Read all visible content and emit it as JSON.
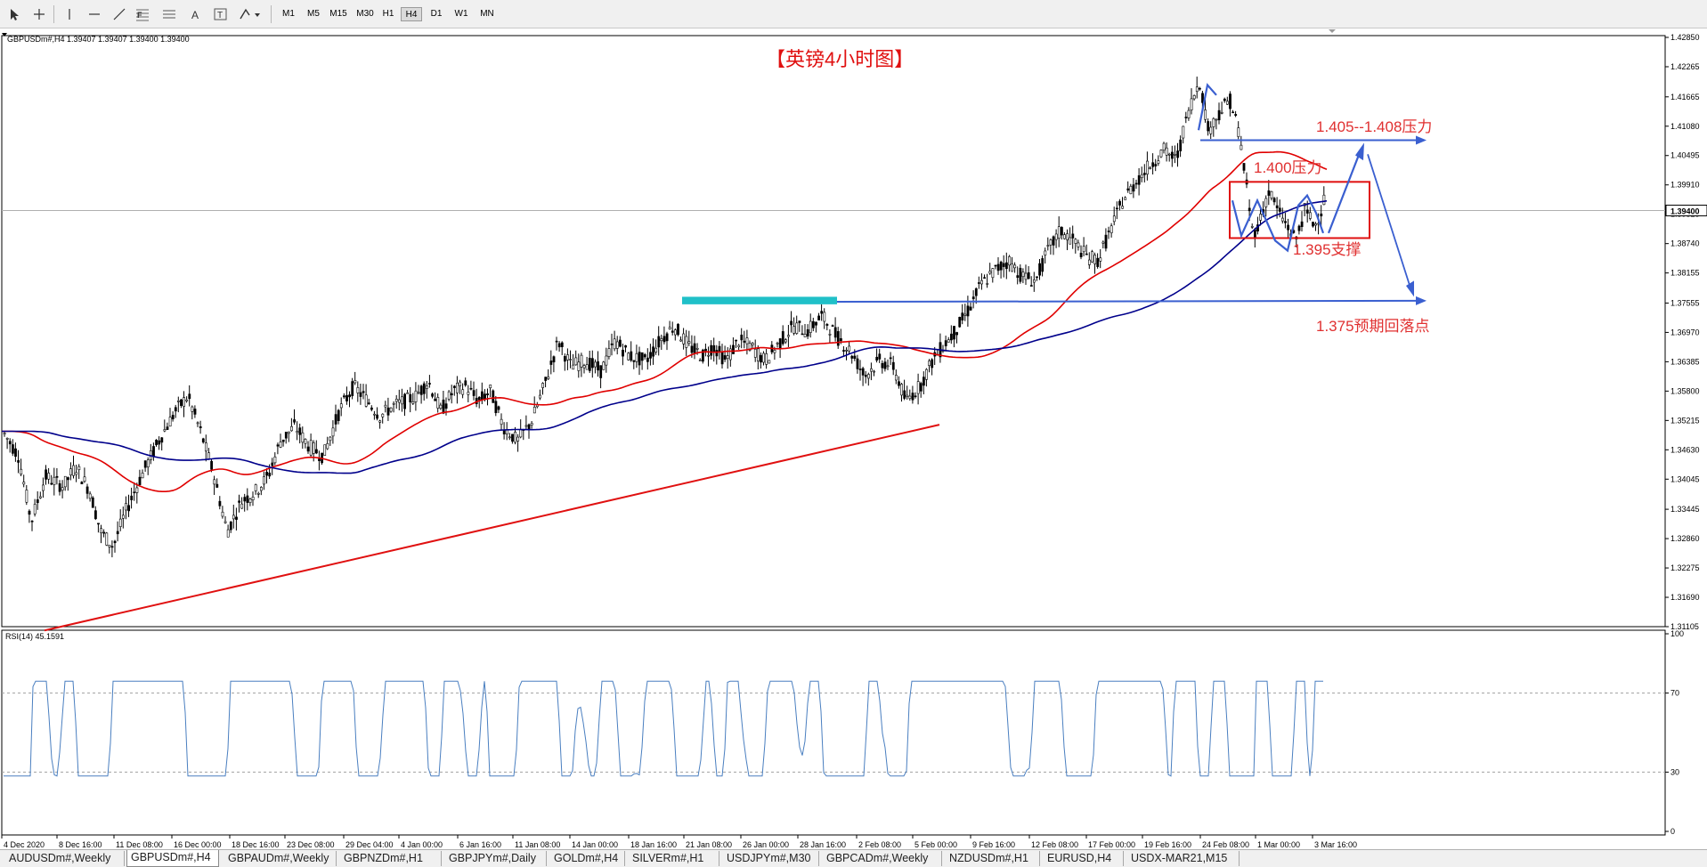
{
  "toolbar": {
    "timeframes": [
      "M1",
      "M5",
      "M15",
      "M30",
      "H1",
      "H4",
      "D1",
      "W1",
      "MN"
    ],
    "active_timeframe": "H4",
    "tools": [
      "cursor-arrow",
      "crosshair",
      "vertical-line",
      "horizontal-line",
      "trendline",
      "fibonacci",
      "fibo-channels",
      "text-label",
      "text-box",
      "arrow-marker"
    ]
  },
  "chart": {
    "header": "GBPUSDm#,H4  1.39407 1.39407 1.39400 1.39400",
    "title": "【英镑4小时图】",
    "current_price": "1.39400",
    "price_axis": [
      "1.42850",
      "1.42265",
      "1.41665",
      "1.41080",
      "1.40495",
      "1.39910",
      "1.39325",
      "1.38740",
      "1.38155",
      "1.37555",
      "1.36970",
      "1.36385",
      "1.35800",
      "1.35215",
      "1.34630",
      "1.34045",
      "1.33445",
      "1.32860",
      "1.32275",
      "1.31690",
      "1.31105"
    ],
    "time_axis": [
      "4 Dec 2020",
      "8 Dec 16:00",
      "11 Dec 08:00",
      "16 Dec 00:00",
      "18 Dec 16:00",
      "23 Dec 08:00",
      "29 Dec 04:00",
      "4 Jan 00:00",
      "6 Jan 16:00",
      "11 Jan 08:00",
      "14 Jan 00:00",
      "18 Jan 16:00",
      "21 Jan 08:00",
      "26 Jan 00:00",
      "28 Jan 16:00",
      "2 Feb 08:00",
      "5 Feb 00:00",
      "9 Feb 16:00",
      "12 Feb 08:00",
      "17 Feb 00:00",
      "19 Feb 16:00",
      "24 Feb 08:00",
      "1 Mar 00:00",
      "3 Mar 16:00"
    ],
    "annotations": {
      "resistance_high": "1.405--1.408压力",
      "resistance": "1.400压力",
      "support": "1.395支撑",
      "target": "1.375预期回落点"
    },
    "colors": {
      "candle": "#000000",
      "ma_fast": "#e00000",
      "ma_slow": "#00008b",
      "annotation": "#e03030",
      "arrow": "#3a5fd0",
      "zone": "#20c0c8"
    }
  },
  "rsi": {
    "label": "RSI(14) 45.1591",
    "levels": [
      "100",
      "70",
      "30",
      "0"
    ],
    "color": "#4a7fc0"
  },
  "tabs": [
    "AUDUSDm#,Weekly",
    "GBPUSDm#,H4",
    "GBPAUDm#,Weekly",
    "GBPNZDm#,H1",
    "GBPJPYm#,Daily",
    "GOLDm#,H4",
    "SILVERm#,H1",
    "USDJPYm#,M30",
    "GBPCADm#,Weekly",
    "NZDUSDm#,H1",
    "EURUSD,H4",
    "USDX-MAR21,M15"
  ],
  "active_tab": "GBPUSDm#,H4"
}
